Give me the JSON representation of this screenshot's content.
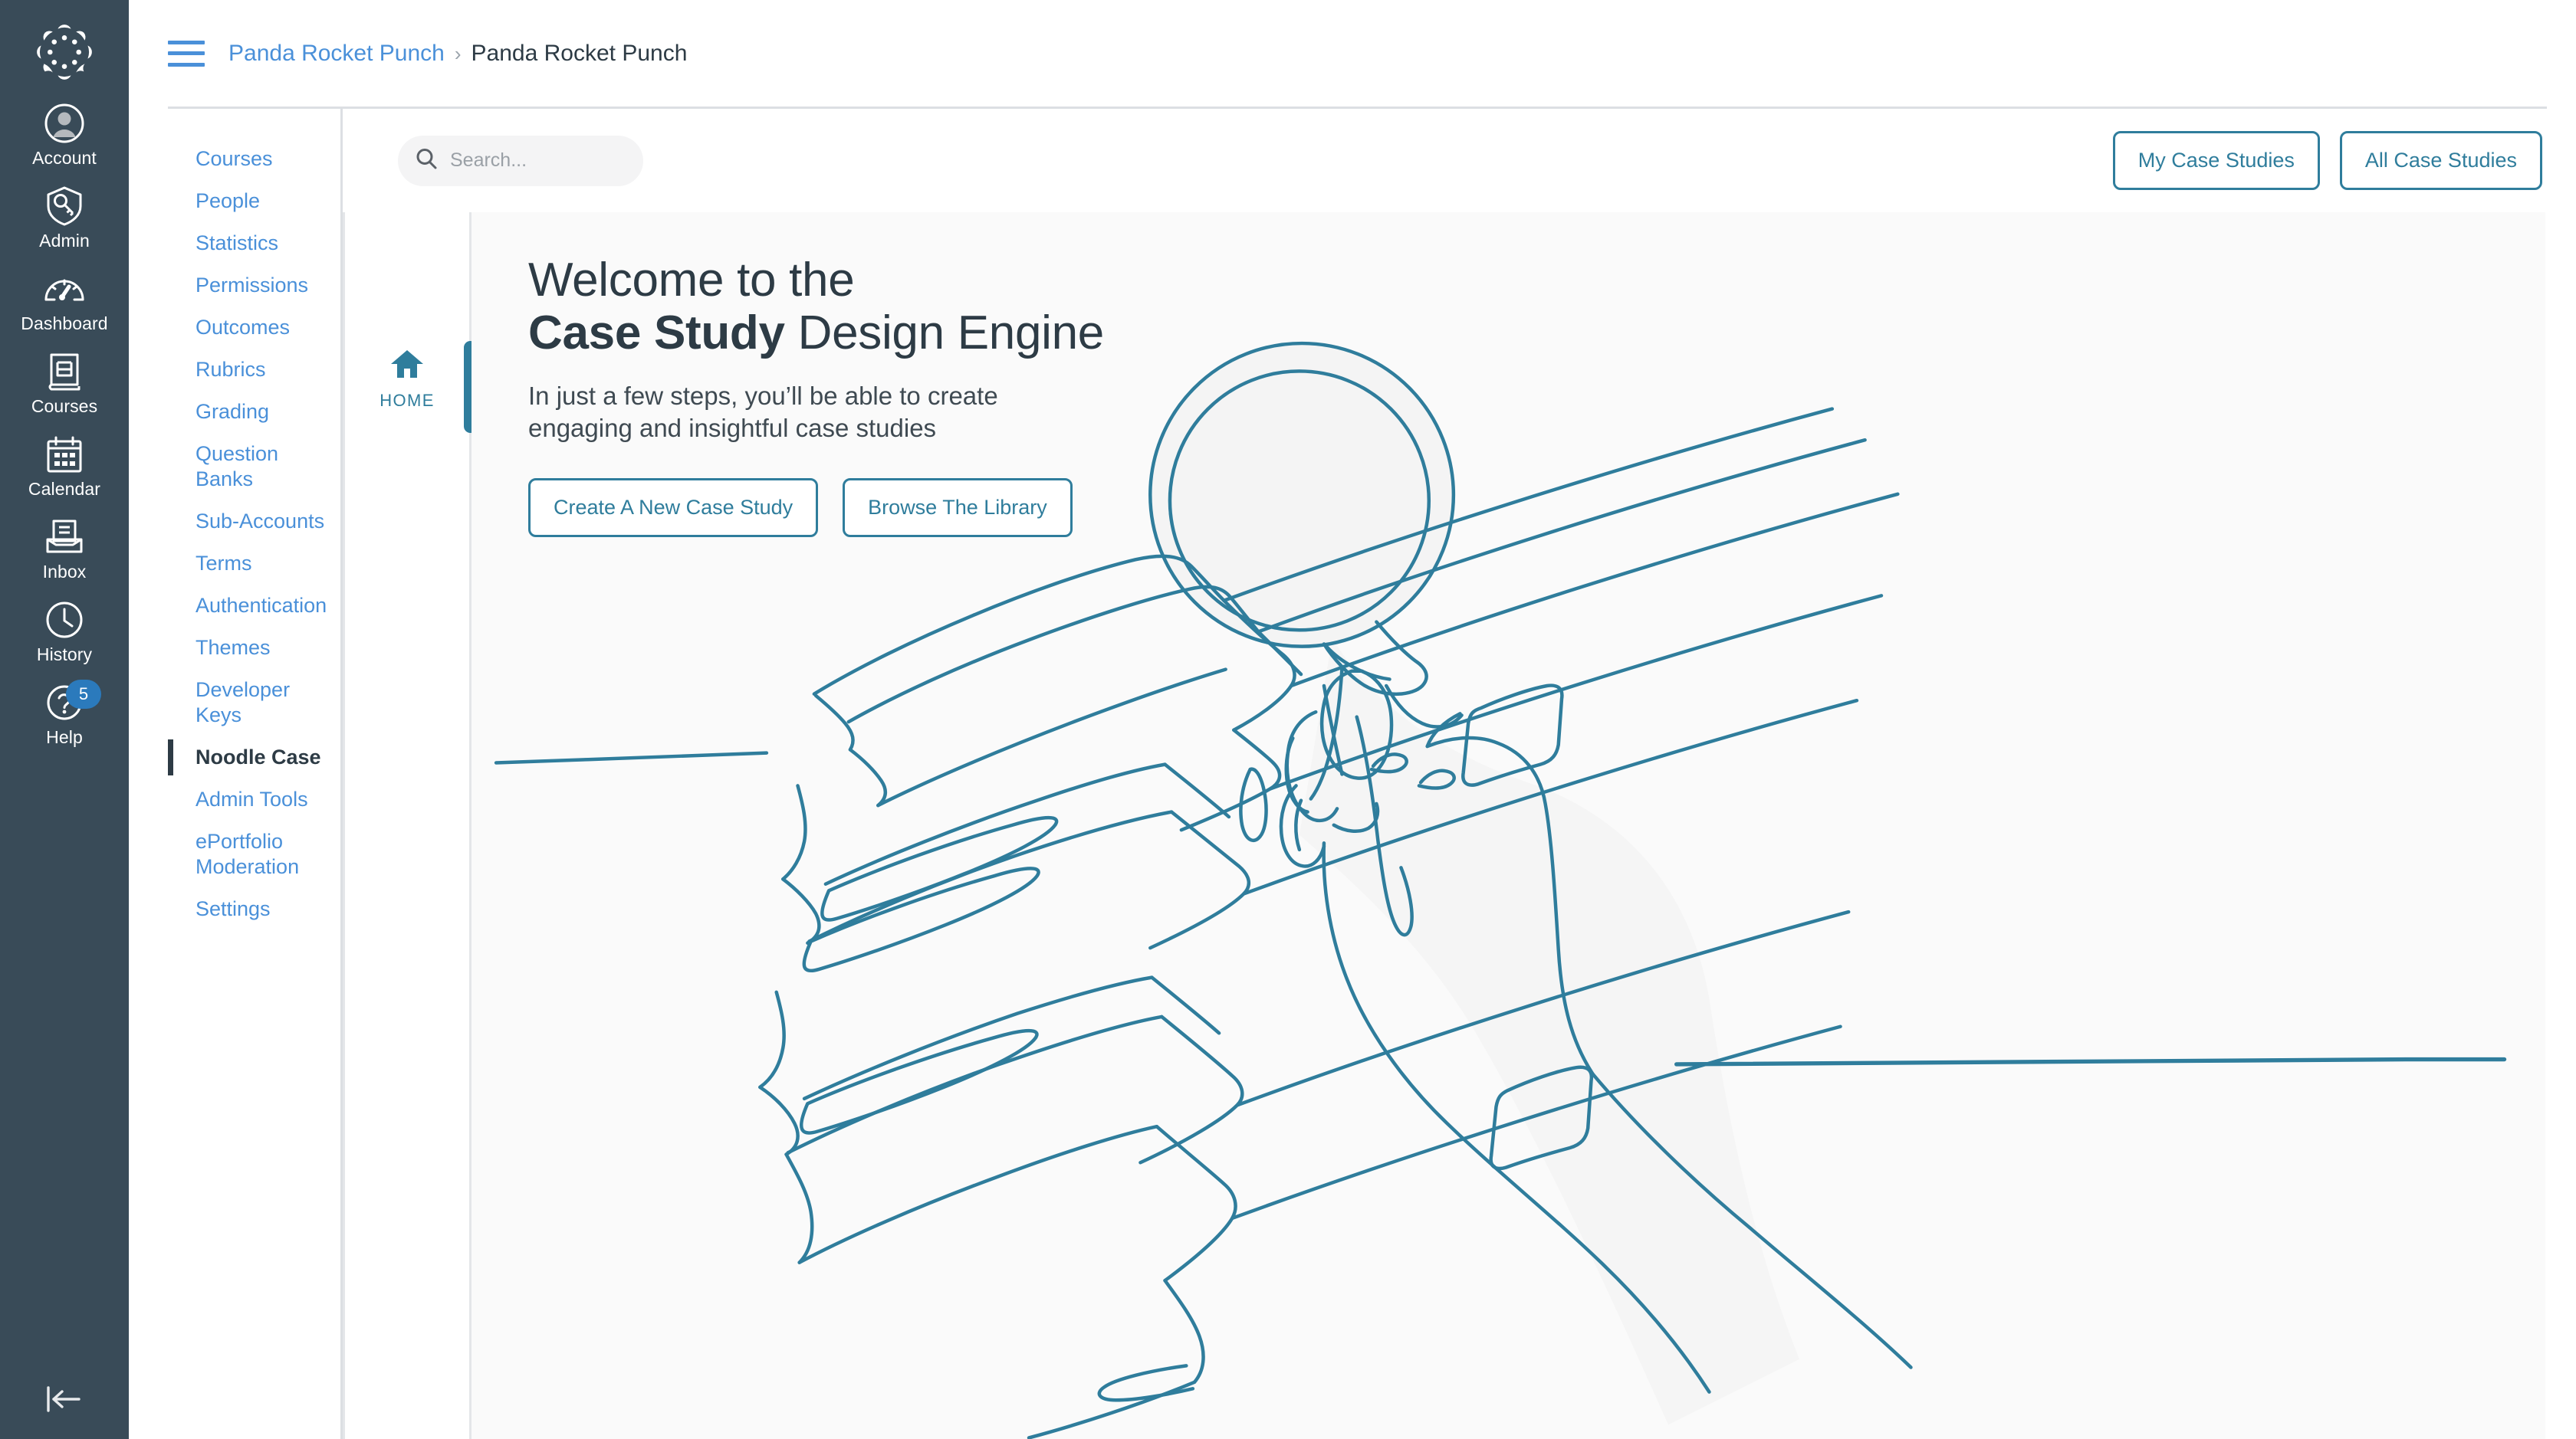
{
  "global_nav": {
    "logo_name": "canvas-logo",
    "items": [
      {
        "label": "Account",
        "icon": "user-avatar-icon",
        "badge": null
      },
      {
        "label": "Admin",
        "icon": "shield-key-icon",
        "badge": null
      },
      {
        "label": "Dashboard",
        "icon": "gauge-icon",
        "badge": null
      },
      {
        "label": "Courses",
        "icon": "book-icon",
        "badge": null
      },
      {
        "label": "Calendar",
        "icon": "calendar-icon",
        "badge": null
      },
      {
        "label": "Inbox",
        "icon": "inbox-icon",
        "badge": null
      },
      {
        "label": "History",
        "icon": "clock-icon",
        "badge": null
      },
      {
        "label": "Help",
        "icon": "question-circle-icon",
        "badge": "5"
      }
    ],
    "collapse_icon": "collapse-left-icon"
  },
  "header": {
    "menu_icon": "hamburger-menu-icon",
    "breadcrumb": [
      {
        "label": "Panda Rocket Punch",
        "current": false
      },
      {
        "label": "Panda Rocket Punch",
        "current": true
      }
    ],
    "separator": "›"
  },
  "account_nav": {
    "items": [
      {
        "label": "Courses",
        "active": false
      },
      {
        "label": "People",
        "active": false
      },
      {
        "label": "Statistics",
        "active": false
      },
      {
        "label": "Permissions",
        "active": false
      },
      {
        "label": "Outcomes",
        "active": false
      },
      {
        "label": "Rubrics",
        "active": false
      },
      {
        "label": "Grading",
        "active": false
      },
      {
        "label": "Question Banks",
        "active": false
      },
      {
        "label": "Sub-Accounts",
        "active": false
      },
      {
        "label": "Terms",
        "active": false
      },
      {
        "label": "Authentication",
        "active": false
      },
      {
        "label": "Themes",
        "active": false
      },
      {
        "label": "Developer Keys",
        "active": false
      },
      {
        "label": "Noodle Case",
        "active": true
      },
      {
        "label": "Admin Tools",
        "active": false
      },
      {
        "label": "ePortfolio Moderation",
        "active": false
      },
      {
        "label": "Settings",
        "active": false
      }
    ]
  },
  "tool": {
    "search": {
      "icon": "search-icon",
      "value": "",
      "placeholder": "Search..."
    },
    "actions": [
      {
        "label": "My Case Studies"
      },
      {
        "label": "All Case Studies"
      }
    ],
    "tabs": [
      {
        "label": "HOME",
        "icon": "home-icon",
        "active": true
      }
    ],
    "hero": {
      "title_line1": "Welcome to the",
      "title_bold": "Case Study",
      "title_rest": " Design Engine",
      "subtitle_line1": "In just a few steps, you’ll be able to create",
      "subtitle_line2": "engaging and insightful case studies",
      "buttons": [
        {
          "label": "Create A New Case Study"
        },
        {
          "label": "Browse The Library"
        }
      ],
      "illustration": "line-drawing-hand-magnifying-glass-books"
    }
  },
  "colors": {
    "global_nav_bg": "#394B58",
    "link_blue": "#4A90D9",
    "teal_accent": "#2F7D9C",
    "badge_blue": "#2B7ABC",
    "text_dark": "#2D3B45",
    "hero_bg": "#fafafa",
    "illustration_stroke": "#2F7D9C"
  }
}
